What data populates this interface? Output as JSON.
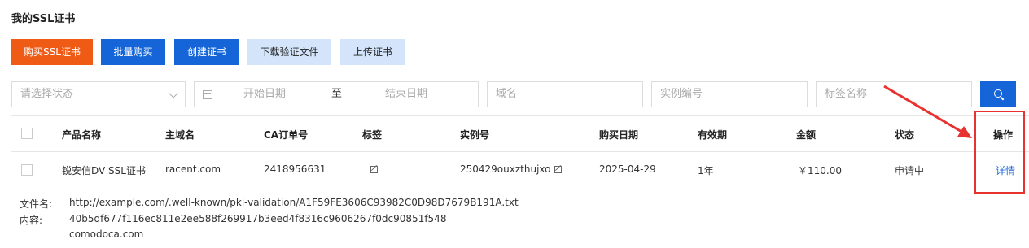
{
  "page_title": "我的SSL证书",
  "toolbar": {
    "buy_ssl": "购买SSL证书",
    "bulk_buy": "批量购买",
    "create_cert": "创建证书",
    "download_verify": "下载验证文件",
    "upload_cert": "上传证书"
  },
  "filters": {
    "status_placeholder": "请选择状态",
    "start_date": "开始日期",
    "to": "至",
    "end_date": "结束日期",
    "domain_placeholder": "域名",
    "instance_placeholder": "实例编号",
    "tag_placeholder": "标签名称"
  },
  "table": {
    "headers": [
      "产品名称",
      "主域名",
      "CA订单号",
      "标签",
      "实例号",
      "购买日期",
      "有效期",
      "金额",
      "状态",
      "操作"
    ],
    "row": {
      "product": "锐安信DV SSL证书",
      "domain": "racent.com",
      "ca_order": "2418956631",
      "instance": "250429ouxzthujxo",
      "purchase_date": "2025-04-29",
      "validity": "1年",
      "amount": "￥110.00",
      "status": "申请中",
      "action": "详情"
    }
  },
  "verify": {
    "file_label": "文件名:",
    "file_value": "http://example.com/.well-known/pki-validation/A1F59FE3606C93982C0D98D7679B191A.txt",
    "content_label": "内容:",
    "content_line1": "40b5df677f116ec811e2ee588f269917b3eed4f8316c9606267f0dc90851f548",
    "content_line2": "comodoca.com"
  },
  "colors": {
    "brand_orange": "#ef5a15",
    "primary_blue": "#1565d8",
    "light_blue": "#d4e5fb",
    "annotation_red": "#e8322f"
  }
}
